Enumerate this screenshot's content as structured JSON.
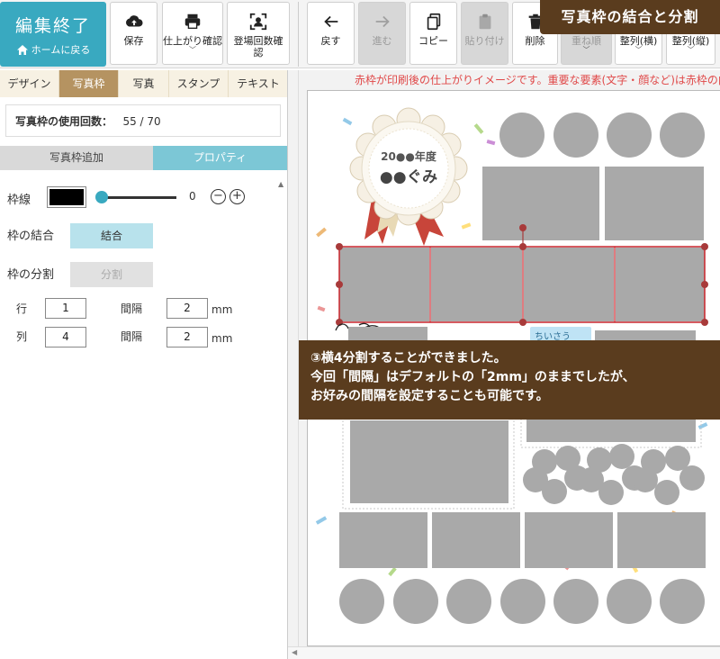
{
  "header": {
    "title_badge": "写真枠の結合と分割",
    "edit_end": {
      "label": "編集終了",
      "home_label": "ホームに戻る"
    },
    "buttons": {
      "save": "保存",
      "preview": "仕上がり確認",
      "count_line1": "登場回数確",
      "count_line2": "認",
      "back": "戻す",
      "forward": "進む",
      "copy": "コピー",
      "paste": "貼り付け",
      "delete": "削除",
      "order": "重ね順",
      "align_h": "整列(横)",
      "align_v": "整列(縦)"
    }
  },
  "tabs": [
    "デザイン",
    "写真枠",
    "写真",
    "スタンプ",
    "テキスト"
  ],
  "usage": {
    "label": "写真枠の使用回数：",
    "value": "55 / 70"
  },
  "subtabs": {
    "add": "写真枠追加",
    "props": "プロパティ"
  },
  "properties": {
    "border_label": "枠線",
    "border_value": "0",
    "minus": "−",
    "plus": "+",
    "merge_label": "枠の結合",
    "merge_button": "結合",
    "split_label": "枠の分割",
    "split_button": "分割",
    "row_label": "行",
    "row_value": "1",
    "col_label": "列",
    "col_value": "4",
    "gap_label": "間隔",
    "gap_row_value": "2",
    "gap_col_value": "2",
    "unit": "mm"
  },
  "canvas": {
    "notice": "赤枠が印刷後の仕上がりイメージです。重要な要素(文字・顔など)は赤枠の内側",
    "rosette_year": "20●●年度",
    "rosette_class": "●●ぐみ",
    "small_label": "ちいさう"
  },
  "callout": {
    "line1": "③横4分割することができました。",
    "line2": "今回「間隔」はデフォルトの「2mm」のままでしたが、",
    "line3": "お好みの間隔を設定することも可能です。"
  },
  "colors": {
    "accent": "#39a9c0",
    "tab_active": "#b59361",
    "callout_bg": "#5a3c1e",
    "frame_gray": "#a9a9a9",
    "selection_red": "#c9242b"
  }
}
